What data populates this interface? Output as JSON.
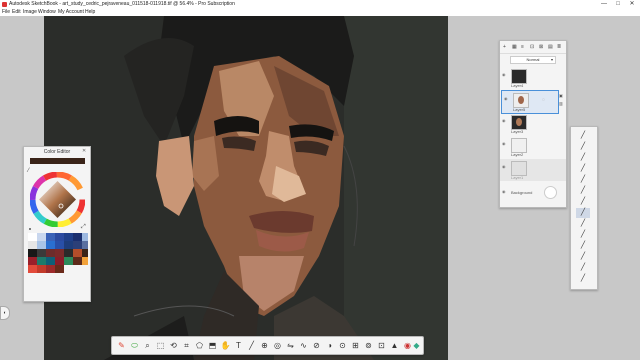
{
  "window": {
    "title": "Autodesk SketchBook - art_study_cedric_pejraveneau_011518-011918.tif @ 56.4% - Pro Subscription",
    "minimize_glyph": "—",
    "maximize_glyph": "□",
    "close_glyph": "✕"
  },
  "menu": {
    "items": [
      "File",
      "Edit",
      "Image",
      "Window",
      "My Account",
      "Help"
    ]
  },
  "color_editor": {
    "title": "Color Editor",
    "current_color": "#3a2418",
    "close_glyph": "✕",
    "swatches": [
      "#ffffff",
      "#c9d7ee",
      "#3a62b8",
      "#2b4aa0",
      "#1f3f8a",
      "#1a2e6e",
      "#9cb8e0",
      "#e6e6e6",
      "#a8c4e8",
      "#2a6fd0",
      "#294fa8",
      "#1e3d7c",
      "#2b3f78",
      "#5a6fa0",
      "#181818",
      "#3a3a3a",
      "#6c2c2c",
      "#7a2a2a",
      "#2a2a2a",
      "#b44e2a",
      "#3a2418",
      "#9a1f2a",
      "#1e7a6a",
      "#0f5f78",
      "#8a1c2a",
      "#2c8a5a",
      "#5d2a1a",
      "#f2a23a",
      "#e24a3a",
      "#c23a2a",
      "#9e2a2a",
      "#6a2a1a"
    ]
  },
  "layers": {
    "blend_mode": "Normal",
    "toolbar_icons": [
      "+",
      "▦",
      "≡",
      "⊡",
      "⊠",
      "▤",
      "≣"
    ],
    "rows": [
      {
        "name": "Layer4",
        "selected": false
      },
      {
        "name": "Layer5",
        "selected": true
      },
      {
        "name": "Layer3",
        "selected": false
      },
      {
        "name": "Layer2",
        "selected": false
      },
      {
        "name": "Layer1",
        "selected": false
      },
      {
        "name": "Background",
        "selected": false
      }
    ]
  },
  "bottom_toolbar": {
    "icons": [
      "✎",
      "⬭",
      "⌕",
      "⬚",
      "⟲",
      "⌗",
      "⬠",
      "⬒",
      "✋",
      "T",
      "╱",
      "⊕",
      "◎",
      "⇋",
      "∿",
      "⊘",
      "◑",
      "⊙",
      "⊞",
      "⊚",
      "⊡",
      "▲",
      "◉",
      "◆"
    ]
  },
  "right_toolbar": {
    "icons": [
      "╱",
      "╱",
      "╱",
      "╱",
      "╱",
      "╱",
      "╱",
      "╱",
      "╱",
      "╱",
      "╱",
      "╱",
      "╱",
      "╱"
    ]
  }
}
